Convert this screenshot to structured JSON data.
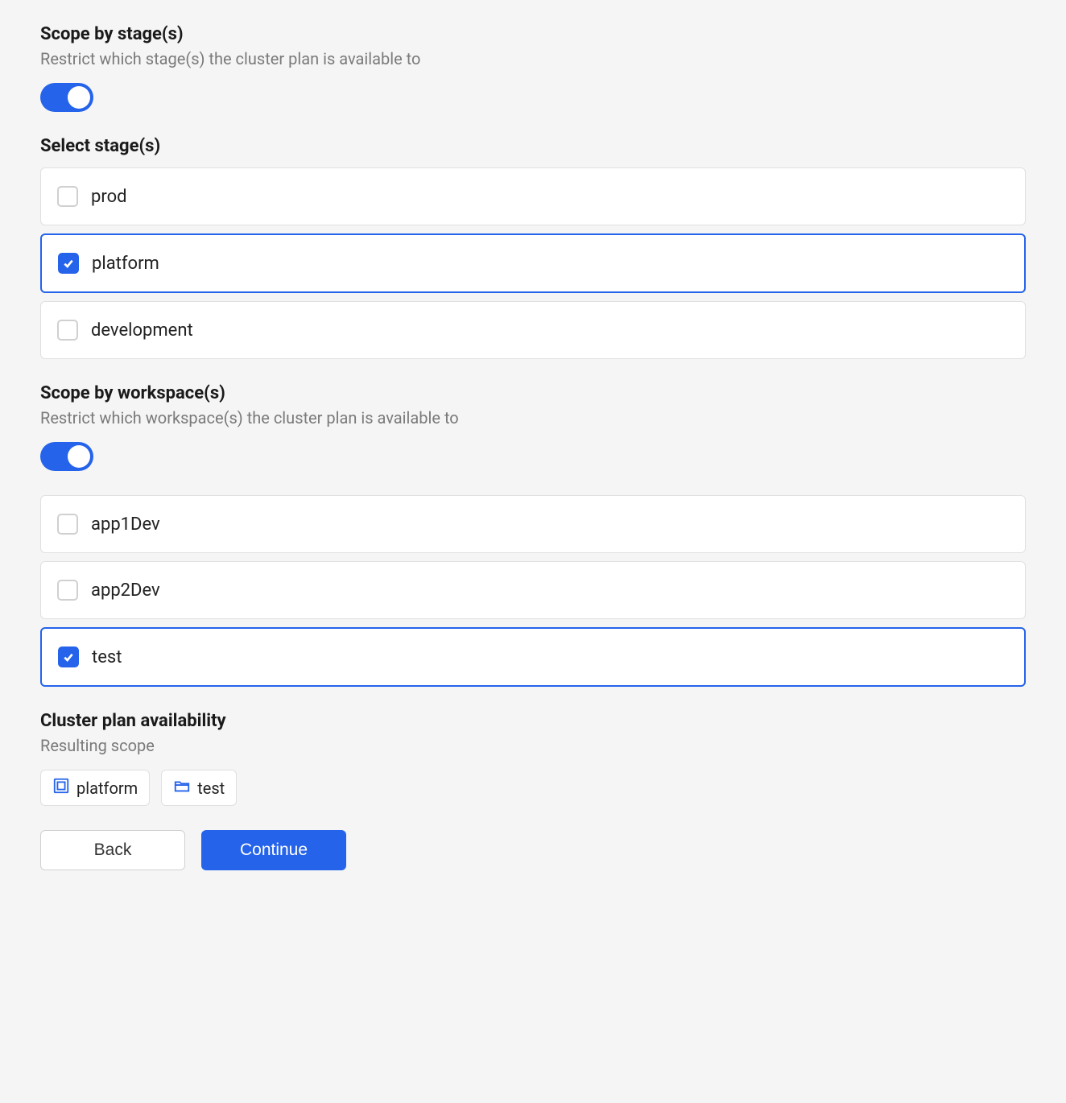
{
  "scopeStage": {
    "title": "Scope by stage(s)",
    "desc": "Restrict which stage(s) the cluster plan is available to",
    "toggle": true
  },
  "selectStage": {
    "title": "Select stage(s)",
    "options": [
      {
        "label": "prod",
        "checked": false
      },
      {
        "label": "platform",
        "checked": true
      },
      {
        "label": "development",
        "checked": false
      }
    ]
  },
  "scopeWorkspace": {
    "title": "Scope by workspace(s)",
    "desc": "Restrict which workspace(s) the cluster plan is available to",
    "toggle": true
  },
  "selectWorkspace": {
    "options": [
      {
        "label": "app1Dev",
        "checked": false
      },
      {
        "label": "app2Dev",
        "checked": false
      },
      {
        "label": "test",
        "checked": true
      }
    ]
  },
  "availability": {
    "title": "Cluster plan availability",
    "desc": "Resulting scope",
    "chips": [
      {
        "icon": "stage-icon",
        "label": "platform"
      },
      {
        "icon": "folder-icon",
        "label": "test"
      }
    ]
  },
  "actions": {
    "back": "Back",
    "continue": "Continue"
  },
  "colors": {
    "accent": "#2563eb"
  }
}
